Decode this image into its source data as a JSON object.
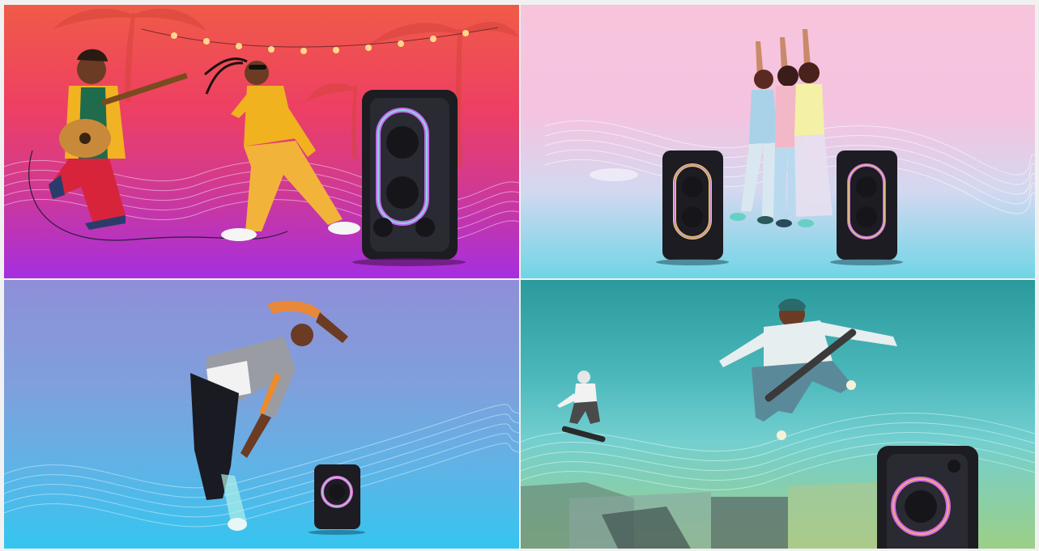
{
  "collage": {
    "panels": [
      {
        "scene": "guitarist-and-dancer-with-speaker",
        "colors": {
          "top": "#f05b47",
          "bottom": "#a52ee0"
        }
      },
      {
        "scene": "three-dancers-with-two-speakers",
        "colors": {
          "top": "#f7c4dc",
          "bottom": "#6fd5e6"
        }
      },
      {
        "scene": "breakdancer-with-small-speaker",
        "colors": {
          "top": "#8e8fd8",
          "bottom": "#34c5ef"
        }
      },
      {
        "scene": "skateboarders-with-speaker",
        "colors": {
          "top": "#2b9a9c",
          "bottom": "#9ccf86"
        }
      }
    ]
  }
}
